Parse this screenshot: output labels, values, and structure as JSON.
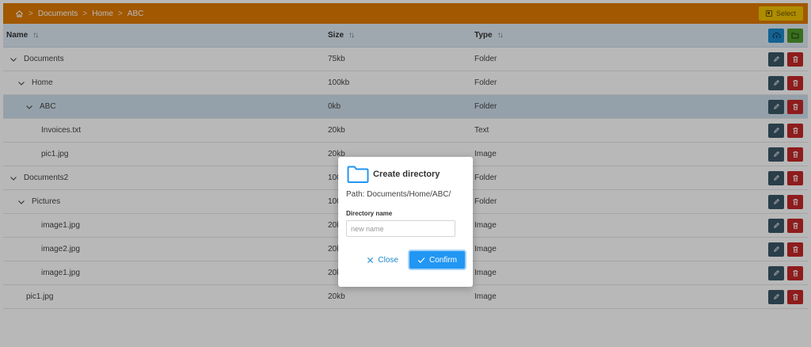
{
  "breadcrumb": [
    "Documents",
    "Home",
    "ABC"
  ],
  "toolbar": {
    "select_label": "Select"
  },
  "table": {
    "headers": {
      "name": "Name",
      "size": "Size",
      "type": "Type"
    },
    "rows": [
      {
        "name": "Documents",
        "size": "75kb",
        "type": "Folder"
      },
      {
        "name": "Home",
        "size": "100kb",
        "type": "Folder"
      },
      {
        "name": "ABC",
        "size": "0kb",
        "type": "Folder"
      },
      {
        "name": "Invoices.txt",
        "size": "20kb",
        "type": "Text"
      },
      {
        "name": "pic1.jpg",
        "size": "20kb",
        "type": "Image"
      },
      {
        "name": "Documents2",
        "size": "100kb",
        "type": "Folder"
      },
      {
        "name": "Pictures",
        "size": "100kb",
        "type": "Folder"
      },
      {
        "name": "image1.jpg",
        "size": "20kb",
        "type": "Image"
      },
      {
        "name": "image2.jpg",
        "size": "20kb",
        "type": "Image"
      },
      {
        "name": "image1.jpg",
        "size": "20kb",
        "type": "Image"
      },
      {
        "name": "pic1.jpg",
        "size": "20kb",
        "type": "Image"
      }
    ]
  },
  "dialog": {
    "title": "Create directory",
    "path": "Path: Documents/Home/ABC/",
    "field_label": "Directory name",
    "placeholder": "new name",
    "close_label": "Close",
    "confirm_label": "Confirm"
  },
  "colors": {
    "topbar": "#e07b00",
    "select_button": "#f2c200",
    "upload_button": "#1d88c9",
    "new_folder_button": "#4f9a2d",
    "edit_button": "#3b5766",
    "delete_button": "#c62828",
    "confirm_button": "#2196f3"
  },
  "icons": [
    "home-icon",
    "chevron-right-icon",
    "sort-icon",
    "cloud-upload-icon",
    "folder-add-icon",
    "chevron-down-icon",
    "edit-icon",
    "trash-icon",
    "folder-icon",
    "close-icon",
    "check-icon"
  ]
}
